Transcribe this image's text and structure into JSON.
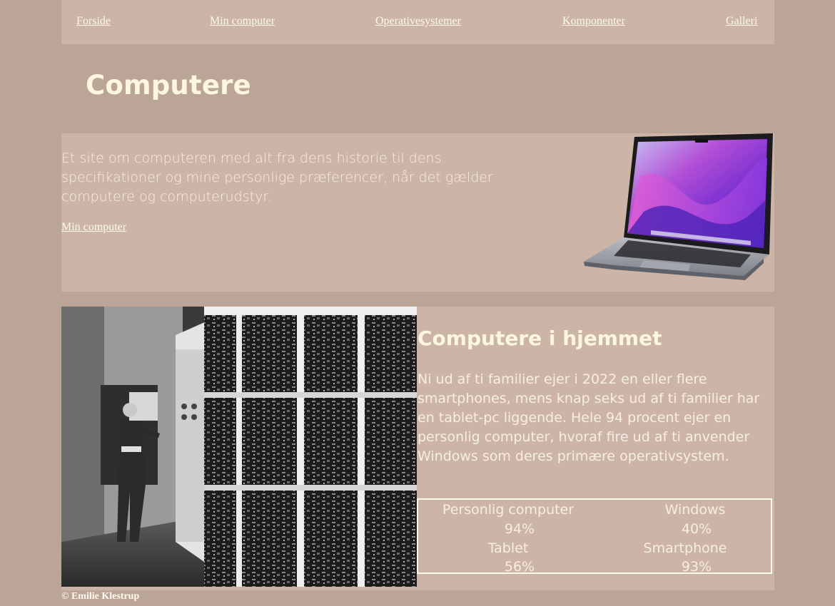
{
  "nav": {
    "items": [
      {
        "label": "Forside"
      },
      {
        "label": "Min computer"
      },
      {
        "label": "Operativesystemer"
      },
      {
        "label": "Komponenter"
      },
      {
        "label": "Galleri"
      }
    ]
  },
  "header": {
    "title": "Computere"
  },
  "intro": {
    "text": "Et site om computeren med alt fra dens historie til dens specifikationer og mine personlige præferencer, når det gælder computere og computerudstyr.",
    "link_label": "Min computer"
  },
  "home": {
    "title": "Computere i hjemmet",
    "text": "Ni ud af ti familier ejer i 2022 en eller flere smartphones, mens knap seks ud af ti familier har en tablet-pc liggende. Hele 94 procent ejer en personlig computer, hvoraf fire ud af ti anvender Windows som deres primære operativsystem.",
    "stats": [
      {
        "label": "Personlig computer",
        "value": "94%"
      },
      {
        "label": "Windows",
        "value": "40%"
      },
      {
        "label": "Tablet",
        "value": "56%"
      },
      {
        "label": "Smartphone",
        "value": "93%"
      }
    ]
  },
  "footer": {
    "text": "© Emilie Klestrup"
  },
  "colors": {
    "page_bg": "#bba596",
    "panel_bg": "#ccb4a6",
    "heading": "#fff6e0",
    "text": "#f7efe6"
  }
}
